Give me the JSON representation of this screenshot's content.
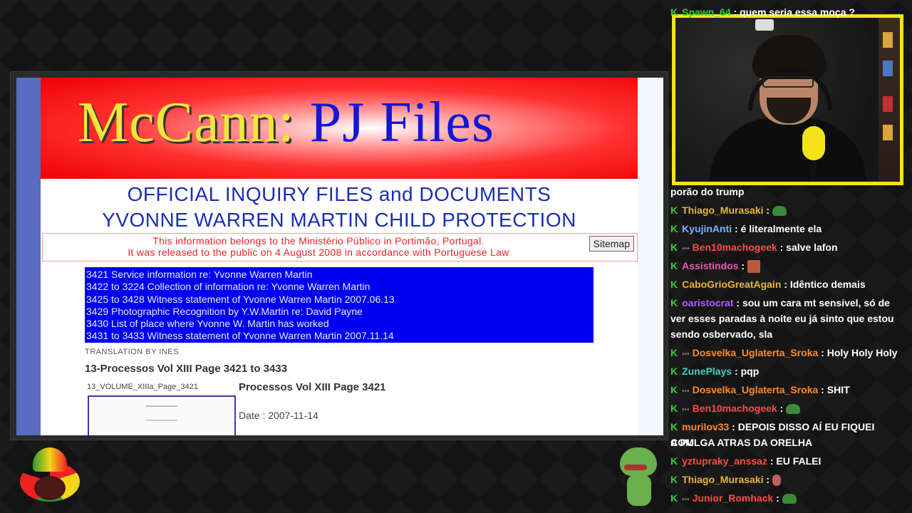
{
  "site": {
    "banner_part1": "McCann:",
    "banner_part2": "PJ Files",
    "headline1": "OFFICIAL INQUIRY FILES and DOCUMENTS",
    "headline2": "YVONNE WARREN MARTIN CHILD PROTECTION",
    "notice1": "This information belongs to the Ministério Público in Portimão, Portugal.",
    "notice2": "It was released to the public on 4 August 2008 in accordance with Portuguese Law",
    "sitemap": "Sitemap",
    "documents": [
      "3421 Service information re: Yvonne Warren Martin",
      "3422 to 3224 Collection of information re: Yvonne Warren Martin",
      "3425 to 3428 Witness statement of Yvonne Warren Martin 2007.06.13",
      "3429 Photographic Recognition by Y.W.Martin re: David Payne",
      "3430 List of place where Yvonne W. Martin has worked",
      "3431 to 3433 Witness statement of Yvonne Warren Martin 2007.11.14"
    ],
    "translation": "TRANSLATION BY INES",
    "proc_heading": "13-Processos Vol XIII Page 3421 to 3433",
    "thumb_caption": "13_VOLUME_XIIIa_Page_3421",
    "page_title": "Processos Vol XIII Page 3421",
    "date_line": "Date : 2007-11-14"
  },
  "chat": [
    {
      "user": "Spawn_64",
      "user_color": "#2fd42f",
      "badge": "k",
      "msg": "quem seria essa moça ?"
    },
    {
      "user": "",
      "user_color": "#ffffff",
      "badge": "",
      "msg": "porão do trump"
    },
    {
      "user": "Thiago_Murasaki",
      "user_color": "#e8b43a",
      "badge": "k",
      "msg": "",
      "emote": "pepe"
    },
    {
      "user": "KyujinAnti",
      "user_color": "#7ab4ff",
      "badge": "k",
      "msg": "é literalmente ela"
    },
    {
      "user": "Ben10machogeek",
      "user_color": "#ff4a4a",
      "badge": "k-sub",
      "msg": "salve lafon"
    },
    {
      "user": "Assistindos",
      "user_color": "#e85ab4",
      "badge": "k",
      "msg": "",
      "emote": "face"
    },
    {
      "user": "CaboGrioGreatAgain",
      "user_color": "#e8b43a",
      "badge": "k",
      "msg": "Idêntico demais"
    },
    {
      "user": "oaristocrat",
      "user_color": "#b45aff",
      "badge": "k",
      "msg": "sou um cara mt sensivel, só de"
    },
    {
      "user": "",
      "user_color": "#ffffff",
      "badge": "",
      "msg": "ver esses paradas à noite eu já sinto que estou"
    },
    {
      "user": "",
      "user_color": "#ffffff",
      "badge": "",
      "msg": "sendo osbervado, sla"
    },
    {
      "user": "Dosvelka_Uglaterta_Sroka",
      "user_color": "#ff8a2a",
      "badge": "k-sub",
      "msg": "Holy Holy Holy"
    },
    {
      "user": "ZunePlays",
      "user_color": "#3ad4c4",
      "badge": "k",
      "msg": "pqp"
    },
    {
      "user": "Dosvelka_Uglaterta_Sroka",
      "user_color": "#ff8a2a",
      "badge": "k-sub",
      "msg": "SHIT"
    },
    {
      "user": "Ben10machogeek",
      "user_color": "#ff4a4a",
      "badge": "k-sub",
      "msg": "",
      "emote": "pepe"
    },
    {
      "user": "murilov33",
      "user_color": "#ff8a2a",
      "badge": "k",
      "msg": "DEPOIS DISSO AÍ EU FIQUEI COM"
    },
    {
      "user": "",
      "user_color": "#ffffff",
      "badge": "",
      "msg": "A PULGA ATRAS DA ORELHA"
    },
    {
      "user": "yztupraky_anssaz",
      "user_color": "#ff4a4a",
      "badge": "k",
      "msg": "EU FALEI"
    },
    {
      "user": "Thiago_Murasaki",
      "user_color": "#e8b43a",
      "badge": "k",
      "msg": "",
      "emote": "hand"
    },
    {
      "user": "Junior_Romhack",
      "user_color": "#ff4a4a",
      "badge": "k-sub",
      "msg": "",
      "emote": "pepe"
    }
  ],
  "colors": {
    "webcam_border": "#f3e419",
    "doc_list_bg": "#0000f0",
    "banner_red": "#ee0000",
    "headline_blue": "#1a2fb0"
  }
}
